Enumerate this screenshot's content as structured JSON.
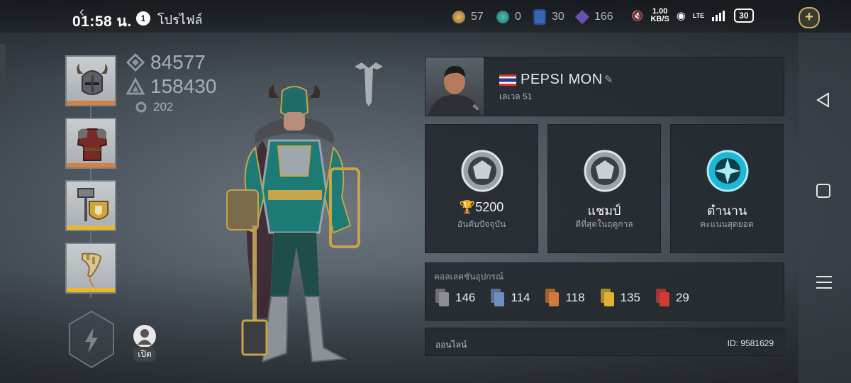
{
  "status_bar": {
    "time": "01:58 น.",
    "notification_count": "1",
    "network_speed_value": "1.00",
    "network_speed_unit": "KB/S",
    "network_type": "LTE",
    "battery": "30"
  },
  "header": {
    "title": "โปรไฟล์",
    "resources": [
      {
        "icon": "gold-coin-icon",
        "value": "57",
        "color": "#c99a4a"
      },
      {
        "icon": "teal-gem-icon",
        "value": "0",
        "color": "#2ea39a"
      },
      {
        "icon": "blue-card-icon",
        "value": "30",
        "color": "#3b63b8"
      },
      {
        "icon": "purple-crystal-icon",
        "value": "166",
        "color": "#7a5cc2"
      }
    ]
  },
  "character": {
    "power": "84577",
    "health": "158430",
    "mini_stat": "202",
    "open_label": "เปิด"
  },
  "equipment": {
    "slots": [
      {
        "name": "helmet",
        "rarity_color": "#d9803e"
      },
      {
        "name": "armor",
        "rarity_color": "#d9803e"
      },
      {
        "name": "hammer-shield",
        "rarity_color": "#e8b830"
      },
      {
        "name": "horn",
        "rarity_color": "#e8b830"
      }
    ]
  },
  "profile": {
    "player_name": "PEPSI   MON",
    "level_label": "เลเวล 51"
  },
  "ranks": [
    {
      "value": "5200",
      "label": "อันดับปัจจุบัน",
      "icon": "silver-rank-icon"
    },
    {
      "value": "แชมป์",
      "label": "ดีที่สุดในฤดูกาล",
      "icon": "silver-rank-icon"
    },
    {
      "value": "ตำนาน",
      "label": "คะแนนสุดยอด",
      "icon": "legend-rank-icon"
    }
  ],
  "collection": {
    "title": "คอลเลคชันอุปกรณ์",
    "items": [
      {
        "count": "146",
        "color": "#8a8f94"
      },
      {
        "count": "114",
        "color": "#6f8fc0"
      },
      {
        "count": "118",
        "color": "#d3773a"
      },
      {
        "count": "135",
        "color": "#e0b22f"
      },
      {
        "count": "29",
        "color": "#d33a34"
      }
    ]
  },
  "footer": {
    "status": "ออนไลน์",
    "id_text": "ID: 9581629"
  }
}
